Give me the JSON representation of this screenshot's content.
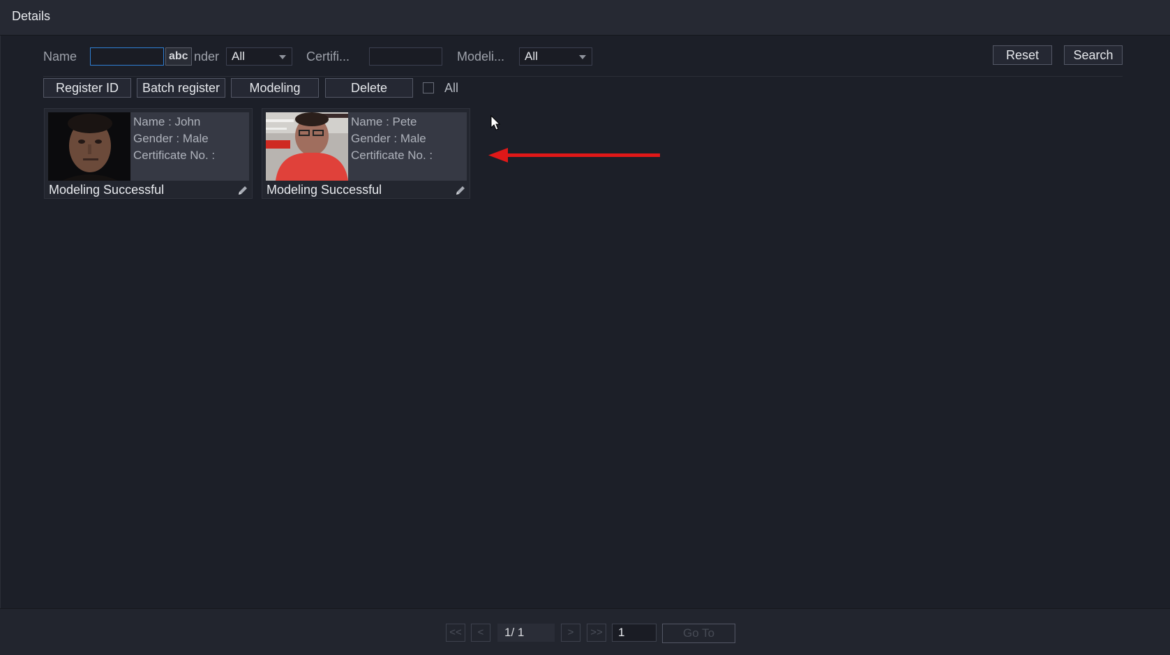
{
  "window": {
    "title": "Details"
  },
  "filters": {
    "name_label": "Name",
    "name_value": "",
    "ime_label": "abc",
    "gender_label": "nder",
    "gender_value": "All",
    "certificate_label": "Certifi...",
    "certificate_value": "",
    "modeling_label": "Modeli...",
    "modeling_value": "All",
    "reset_label": "Reset",
    "search_label": "Search"
  },
  "toolbar": {
    "register_id": "Register ID",
    "batch_register": "Batch register",
    "modeling": "Modeling",
    "delete": "Delete",
    "select_all_label": "All"
  },
  "records": [
    {
      "name": "Name : John",
      "gender": "Gender : Male",
      "certificate": "Certificate No. :",
      "status": "Modeling Successful"
    },
    {
      "name": "Name : Pete",
      "gender": "Gender : Male",
      "certificate": "Certificate No. :",
      "status": "Modeling Successful"
    }
  ],
  "pagination": {
    "first": "<<",
    "prev": "<",
    "page_indicator": "1/  1",
    "next": ">",
    "last": ">>",
    "goto_value": "1",
    "goto_label": "Go To"
  },
  "colors": {
    "accent_focus": "#2f7fd3",
    "annotation_arrow": "#e01818"
  }
}
